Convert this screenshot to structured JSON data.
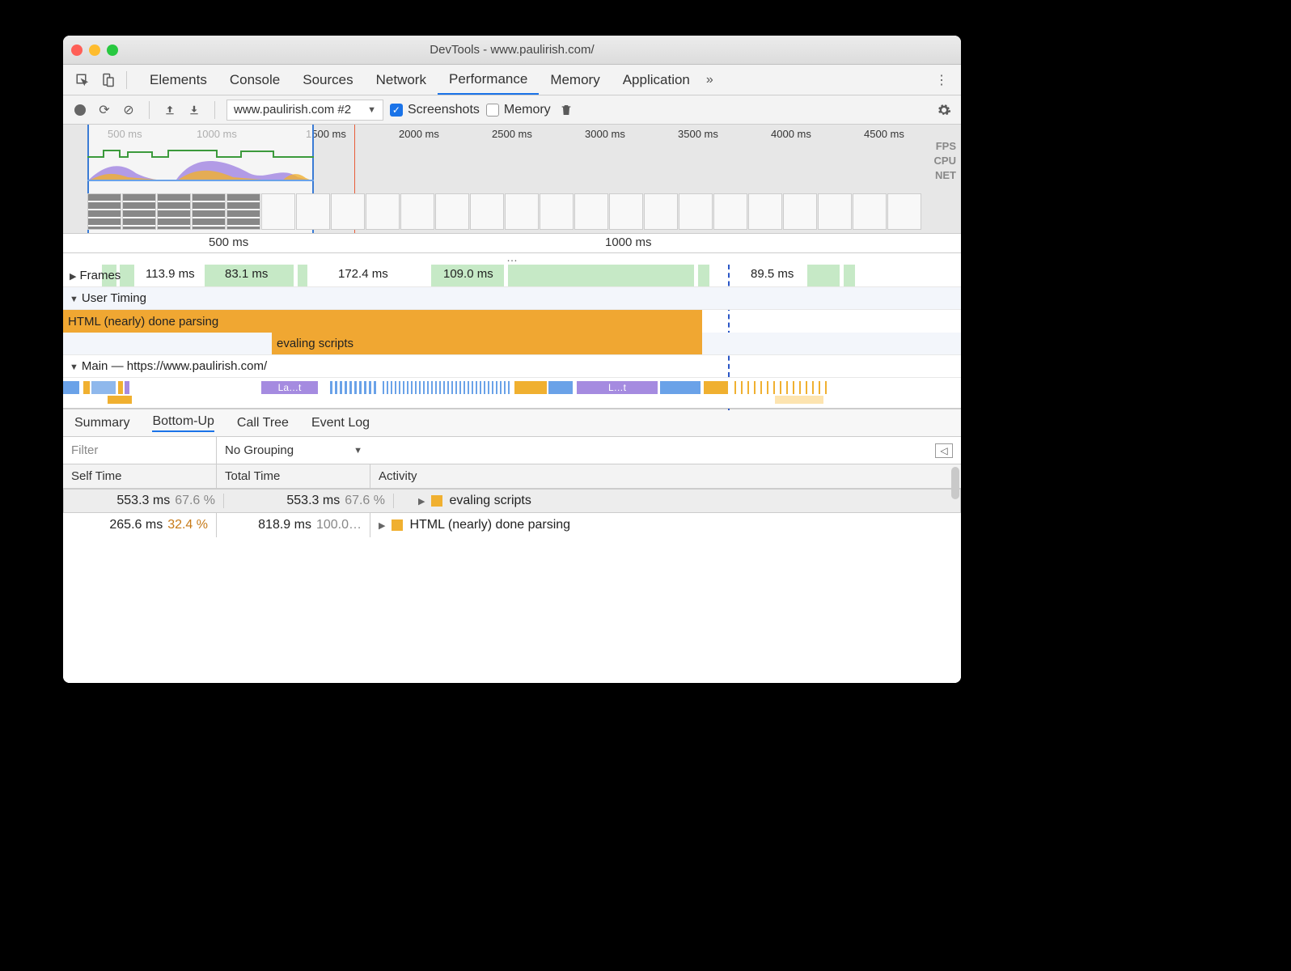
{
  "window": {
    "title": "DevTools - www.paulirish.com/"
  },
  "panel_tabs": [
    "Elements",
    "Console",
    "Sources",
    "Network",
    "Performance",
    "Memory",
    "Application"
  ],
  "panel_active": "Performance",
  "toolbar": {
    "recording_select": "www.paulirish.com #2",
    "screenshots_label": "Screenshots",
    "screenshots_checked": true,
    "memory_label": "Memory",
    "memory_checked": false
  },
  "overview": {
    "times": [
      "500 ms",
      "1000 ms",
      "1500 ms",
      "2000 ms",
      "2500 ms",
      "3000 ms",
      "3500 ms",
      "4000 ms",
      "4500 ms"
    ],
    "lane_labels": [
      "FPS",
      "CPU",
      "NET"
    ]
  },
  "ruler": {
    "ticks": [
      "500 ms",
      "1000 ms"
    ]
  },
  "frames": {
    "label": "Frames",
    "items": [
      "113.9 ms",
      "83.1 ms",
      "172.4 ms",
      "109.0 ms",
      "89.5 ms"
    ]
  },
  "user_timing": {
    "label": "User Timing",
    "bars": [
      "HTML (nearly) done parsing",
      "evaling scripts"
    ]
  },
  "main": {
    "label": "Main — https://www.paulirish.com/",
    "blk1": "La…t",
    "blk2": "L…t"
  },
  "detail_tabs": [
    "Summary",
    "Bottom-Up",
    "Call Tree",
    "Event Log"
  ],
  "detail_active": "Bottom-Up",
  "filter": {
    "placeholder": "Filter",
    "grouping": "No Grouping"
  },
  "columns": {
    "self": "Self Time",
    "total": "Total Time",
    "activity": "Activity"
  },
  "rows": [
    {
      "self_ms": "553.3 ms",
      "self_pct": "67.6 %",
      "total_ms": "553.3 ms",
      "total_pct": "67.6 %",
      "total_bar_pct": 67.6,
      "activity": "evaling scripts",
      "selected": true
    },
    {
      "self_ms": "265.6 ms",
      "self_pct": "32.4 %",
      "self_pct_orange": true,
      "total_ms": "818.9 ms",
      "total_pct": "100.0…",
      "total_bar_pct": 100,
      "activity": "HTML (nearly) done parsing",
      "selected": false
    }
  ]
}
